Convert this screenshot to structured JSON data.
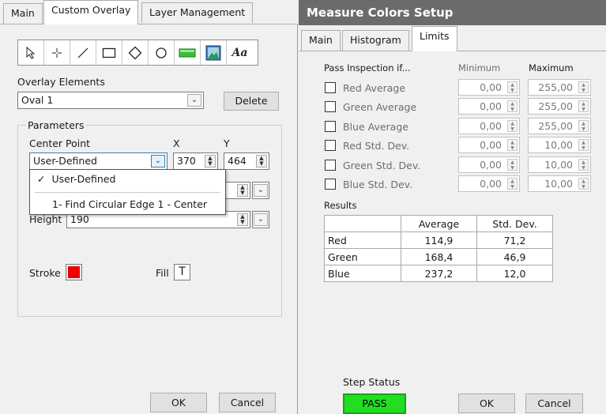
{
  "left": {
    "tabs": [
      {
        "label": "Main"
      },
      {
        "label": "Custom Overlay"
      },
      {
        "label": "Layer Management"
      }
    ],
    "tools": [
      "pointer-tool",
      "crosshair-tool",
      "line-tool",
      "rectangle-tool",
      "diamond-tool",
      "oval-tool",
      "bar-tool",
      "image-tool",
      "text-tool"
    ],
    "text_tool_glyph": "Aa",
    "overlay_elements_label": "Overlay Elements",
    "overlay_selected": "Oval 1",
    "delete_label": "Delete",
    "parameters_label": "Parameters",
    "center_point_label": "Center Point",
    "x_label": "X",
    "y_label": "Y",
    "center_mode": "User-Defined",
    "x_value": "370",
    "y_value": "464",
    "dropdown": {
      "items": [
        "User-Defined",
        "1- Find Circular Edge 1 - Center"
      ],
      "check": "✓"
    },
    "height_label": "Height",
    "height_value": "190",
    "stroke_label": "Stroke",
    "stroke_color": "#ee0000",
    "fill_label": "Fill",
    "fill_glyph": "T",
    "ok_label": "OK",
    "cancel_label": "Cancel"
  },
  "right": {
    "title": "Measure Colors Setup",
    "tabs": [
      {
        "label": "Main"
      },
      {
        "label": "Histogram"
      },
      {
        "label": "Limits"
      }
    ],
    "pass_header": "Pass Inspection if...",
    "min_header": "Minimum",
    "max_header": "Maximum",
    "rows": [
      {
        "label": "Red Average",
        "min": "0,00",
        "max": "255,00"
      },
      {
        "label": "Green Average",
        "min": "0,00",
        "max": "255,00"
      },
      {
        "label": "Blue Average",
        "min": "0,00",
        "max": "255,00"
      },
      {
        "label": "Red Std. Dev.",
        "min": "0,00",
        "max": "10,00"
      },
      {
        "label": "Green Std. Dev.",
        "min": "0,00",
        "max": "10,00"
      },
      {
        "label": "Blue Std. Dev.",
        "min": "0,00",
        "max": "10,00"
      }
    ],
    "results_label": "Results",
    "results_headers": [
      "Average",
      "Std. Dev."
    ],
    "results_rows": [
      {
        "name": "Red",
        "avg": "114,9",
        "std": "71,2"
      },
      {
        "name": "Green",
        "avg": "168,4",
        "std": "46,9"
      },
      {
        "name": "Blue",
        "avg": "237,2",
        "std": "12,0"
      }
    ],
    "step_status_label": "Step Status",
    "status_value": "PASS",
    "status_color": "#22dd22",
    "ok_label": "OK",
    "cancel_label": "Cancel"
  }
}
